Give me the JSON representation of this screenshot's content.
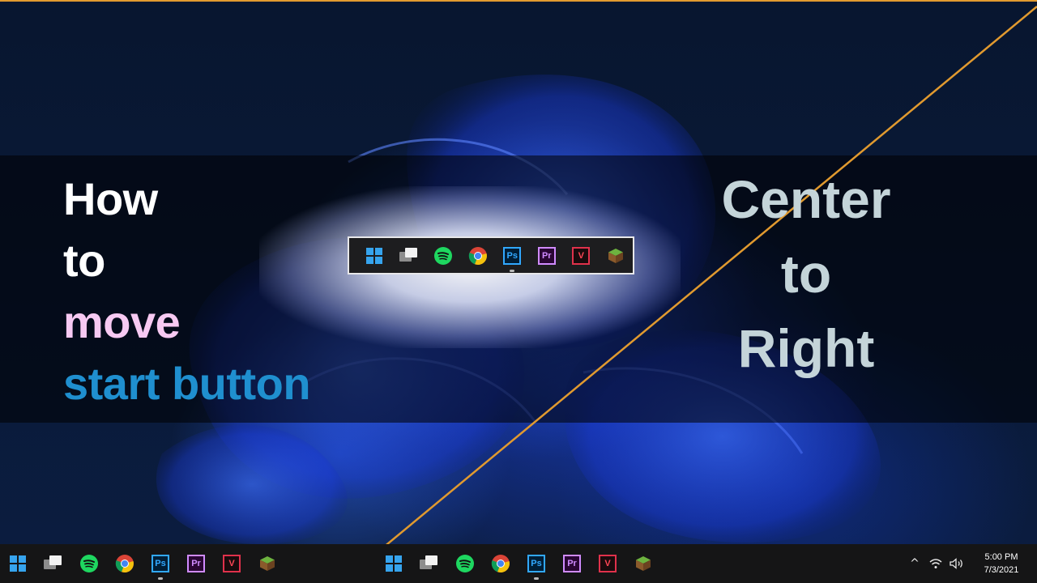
{
  "headline": {
    "line1": "How",
    "line2": "to",
    "line3": "move",
    "line4": "start button"
  },
  "right_text": {
    "line1": "Center",
    "line2": "to",
    "line3": "Right"
  },
  "colors": {
    "accent_orange": "#e19a2f",
    "headline_pink": "#f7c9f2",
    "headline_blue": "#1f8fcf",
    "right_text": "#c4d4d9",
    "taskbar_bg": "#151516"
  },
  "taskbar_apps": [
    {
      "name": "start",
      "icon": "windows-start-icon",
      "running": false
    },
    {
      "name": "task-view",
      "icon": "task-view-icon",
      "running": false
    },
    {
      "name": "spotify",
      "icon": "spotify-icon",
      "running": false
    },
    {
      "name": "chrome",
      "icon": "chrome-icon",
      "running": false
    },
    {
      "name": "photoshop",
      "icon": "photoshop-icon",
      "label": "Ps",
      "running": true
    },
    {
      "name": "premiere",
      "icon": "premiere-icon",
      "label": "Pr",
      "running": false
    },
    {
      "name": "valorant",
      "icon": "valorant-icon",
      "label": "V",
      "running": false
    },
    {
      "name": "minecraft",
      "icon": "minecraft-icon",
      "running": false
    }
  ],
  "tray": {
    "chevron": "^",
    "time": "5:00 PM",
    "date": "7/3/2021"
  }
}
